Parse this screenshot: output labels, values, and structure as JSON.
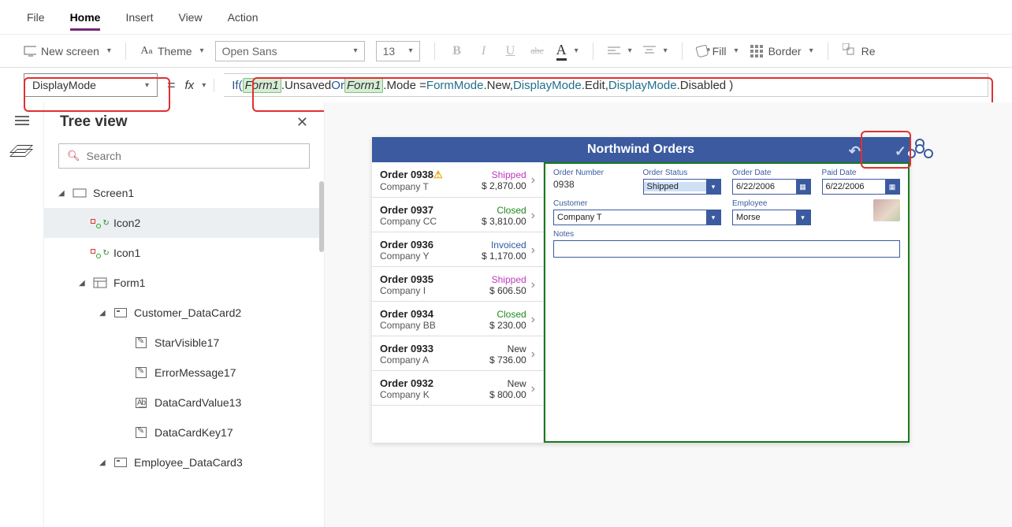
{
  "menu": {
    "file": "File",
    "home": "Home",
    "insert": "Insert",
    "view": "View",
    "action": "Action"
  },
  "ribbon": {
    "newscreen": "New screen",
    "theme": "Theme",
    "font": "Open Sans",
    "size": "13",
    "fill": "Fill",
    "border": "Border",
    "reorder": "Re"
  },
  "prop": {
    "selected": "DisplayMode",
    "fx": "fx",
    "formula_tokens": [
      "If(",
      " ",
      "Form1",
      ".Unsaved ",
      "Or",
      " ",
      "Form1",
      ".Mode = ",
      "FormMode",
      ".New, ",
      "DisplayMode",
      ".Edit, ",
      "DisplayMode",
      ".Disabled )"
    ]
  },
  "tree": {
    "title": "Tree view",
    "search_ph": "Search",
    "items": [
      {
        "label": "Screen1",
        "indent": 18,
        "icon": "screen",
        "twist": "◢"
      },
      {
        "label": "Icon2",
        "indent": 44,
        "icon": "iconset",
        "sel": true
      },
      {
        "label": "Icon1",
        "indent": 44,
        "icon": "iconset"
      },
      {
        "label": "Form1",
        "indent": 44,
        "icon": "form",
        "twist": "◢"
      },
      {
        "label": "Customer_DataCard2",
        "indent": 70,
        "icon": "card",
        "twist": "◢"
      },
      {
        "label": "StarVisible17",
        "indent": 96,
        "icon": "pencil"
      },
      {
        "label": "ErrorMessage17",
        "indent": 96,
        "icon": "pencil"
      },
      {
        "label": "DataCardValue13",
        "indent": 96,
        "icon": "abc"
      },
      {
        "label": "DataCardKey17",
        "indent": 96,
        "icon": "pencil"
      },
      {
        "label": "Employee_DataCard3",
        "indent": 70,
        "icon": "card",
        "twist": "◢"
      }
    ]
  },
  "app": {
    "title": "Northwind Orders",
    "orders": [
      {
        "no": "Order 0938",
        "co": "Company T",
        "status": "Shipped",
        "amt": "$ 2,870.00",
        "warn": true
      },
      {
        "no": "Order 0937",
        "co": "Company CC",
        "status": "Closed",
        "amt": "$ 3,810.00"
      },
      {
        "no": "Order 0936",
        "co": "Company Y",
        "status": "Invoiced",
        "amt": "$ 1,170.00"
      },
      {
        "no": "Order 0935",
        "co": "Company I",
        "status": "Shipped",
        "amt": "$ 606.50"
      },
      {
        "no": "Order 0934",
        "co": "Company BB",
        "status": "Closed",
        "amt": "$ 230.00"
      },
      {
        "no": "Order 0933",
        "co": "Company A",
        "status": "New",
        "amt": "$ 736.00"
      },
      {
        "no": "Order 0932",
        "co": "Company K",
        "status": "New",
        "amt": "$ 800.00"
      }
    ],
    "form": {
      "orderno_lbl": "Order Number",
      "orderno": "0938",
      "status_lbl": "Order Status",
      "status": "Shipped",
      "odate_lbl": "Order Date",
      "odate": "6/22/2006",
      "pdate_lbl": "Paid Date",
      "pdate": "6/22/2006",
      "cust_lbl": "Customer",
      "cust": "Company T",
      "emp_lbl": "Employee",
      "emp": "Morse",
      "notes_lbl": "Notes"
    }
  }
}
